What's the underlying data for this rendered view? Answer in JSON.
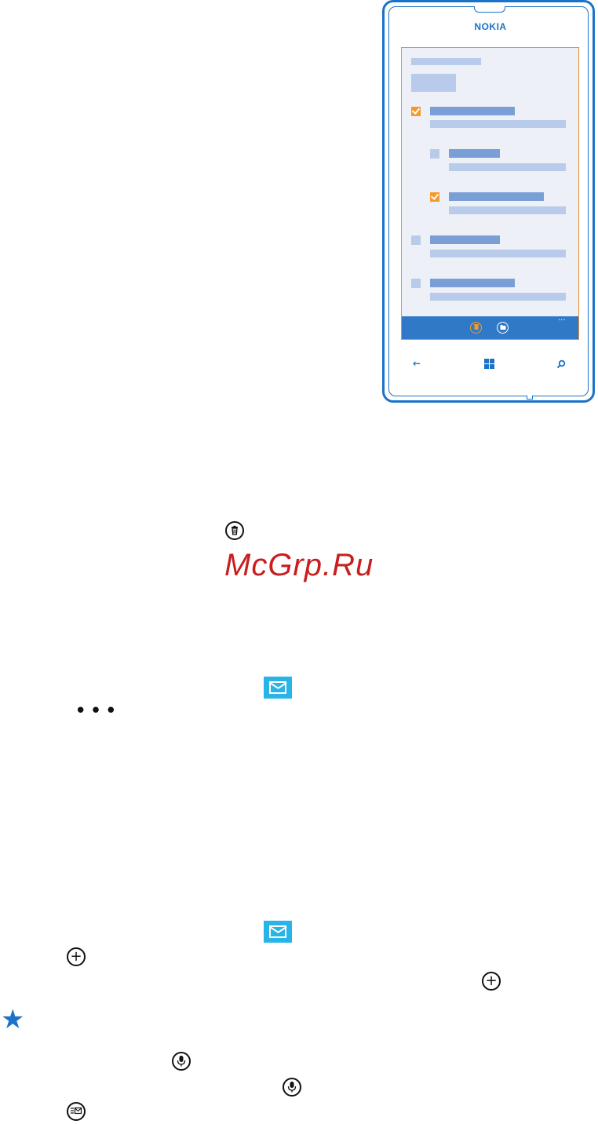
{
  "phone": {
    "brand": "NOKIA",
    "appbar_more": "...",
    "nav_back": "←",
    "nav_search": "⌕"
  },
  "watermark": "McGrp.Ru",
  "icons": {
    "more": "•••",
    "plus": "+",
    "star": "★"
  },
  "colors": {
    "accent": "#1a73c8",
    "highlight": "#f39a2b",
    "mail_tile": "#28b4e6",
    "watermark": "#c81e1e"
  }
}
